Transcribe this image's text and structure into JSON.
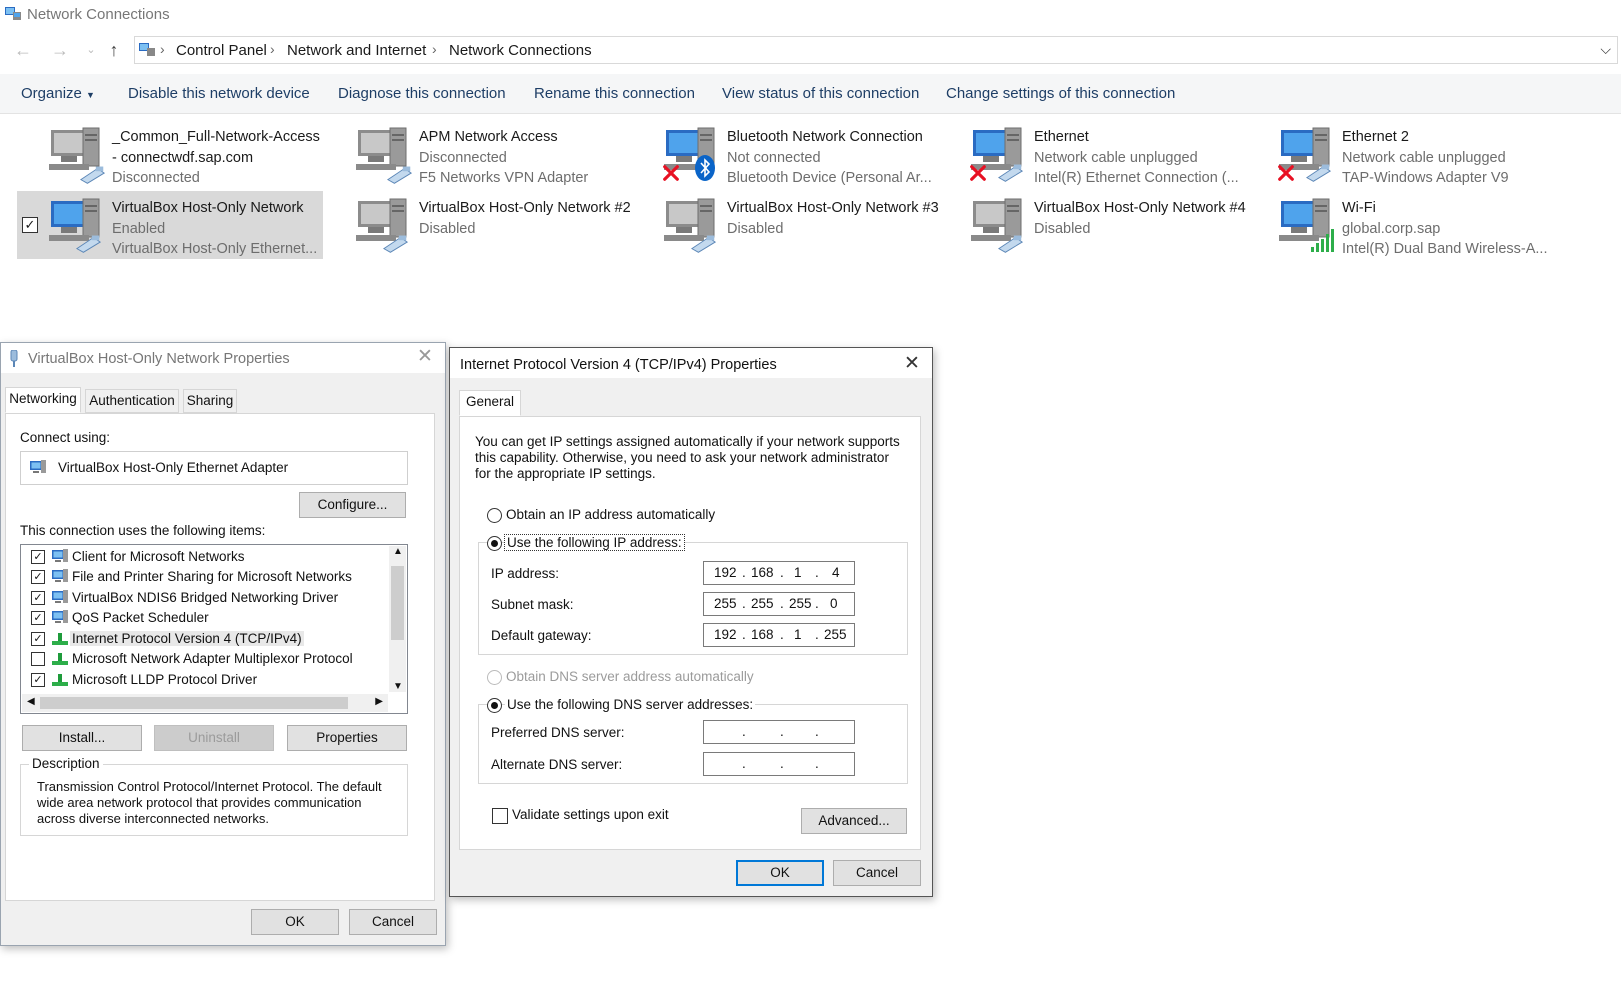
{
  "window": {
    "title": "Network Connections"
  },
  "address": {
    "crumbs": [
      "Control Panel",
      "Network and Internet",
      "Network Connections"
    ]
  },
  "commands": {
    "organize": "Organize",
    "disable": "Disable this network device",
    "diagnose": "Diagnose this connection",
    "rename": "Rename this connection",
    "view_status": "View status of this connection",
    "change_settings": "Change settings of this connection"
  },
  "connections": [
    {
      "name": "_Common_Full-Network-Access - connectwdf.sap.com",
      "status": "Disconnected",
      "device": ""
    },
    {
      "name": "APM Network Access",
      "status": "Disconnected",
      "device": "F5 Networks VPN Adapter"
    },
    {
      "name": "Bluetooth Network Connection",
      "status": "Not connected",
      "device": "Bluetooth Device (Personal Ar..."
    },
    {
      "name": "Ethernet",
      "status": "Network cable unplugged",
      "device": "Intel(R) Ethernet Connection (..."
    },
    {
      "name": "Ethernet 2",
      "status": "Network cable unplugged",
      "device": "TAP-Windows Adapter V9"
    },
    {
      "name": "VirtualBox Host-Only Network",
      "status": "Enabled",
      "device": "VirtualBox Host-Only Ethernet..."
    },
    {
      "name": "VirtualBox Host-Only Network #2",
      "status": "Disabled",
      "device": ""
    },
    {
      "name": "VirtualBox Host-Only Network #3",
      "status": "Disabled",
      "device": ""
    },
    {
      "name": "VirtualBox Host-Only Network #4",
      "status": "Disabled",
      "device": ""
    },
    {
      "name": "Wi-Fi",
      "status": "global.corp.sap",
      "device": "Intel(R) Dual Band Wireless-A..."
    }
  ],
  "props_dialog": {
    "title": "VirtualBox Host-Only Network Properties",
    "tabs": [
      "Networking",
      "Authentication",
      "Sharing"
    ],
    "connect_using_label": "Connect using:",
    "adapter": "VirtualBox Host-Only Ethernet Adapter",
    "configure": "Configure...",
    "items_label": "This connection uses the following items:",
    "items": [
      {
        "label": "Client for Microsoft Networks",
        "checked": true
      },
      {
        "label": "File and Printer Sharing for Microsoft Networks",
        "checked": true
      },
      {
        "label": "VirtualBox NDIS6 Bridged Networking Driver",
        "checked": true
      },
      {
        "label": "QoS Packet Scheduler",
        "checked": true
      },
      {
        "label": "Internet Protocol Version 4 (TCP/IPv4)",
        "checked": true
      },
      {
        "label": "Microsoft Network Adapter Multiplexor Protocol",
        "checked": false
      },
      {
        "label": "Microsoft LLDP Protocol Driver",
        "checked": true
      }
    ],
    "install": "Install...",
    "uninstall": "Uninstall",
    "properties": "Properties",
    "description_label": "Description",
    "description": "Transmission Control Protocol/Internet Protocol. The default wide area network protocol that provides communication across diverse interconnected networks.",
    "ok": "OK",
    "cancel": "Cancel"
  },
  "ipv4_dialog": {
    "title": "Internet Protocol Version 4 (TCP/IPv4) Properties",
    "tab": "General",
    "intro": "You can get IP settings assigned automatically if your network supports this capability. Otherwise, you need to ask your network administrator for the appropriate IP settings.",
    "obtain_ip": "Obtain an IP address automatically",
    "use_ip": "Use the following IP address:",
    "ip_label": "IP address:",
    "ip": [
      "192",
      "168",
      "1",
      "4"
    ],
    "subnet_label": "Subnet mask:",
    "subnet": [
      "255",
      "255",
      "255",
      "0"
    ],
    "gateway_label": "Default gateway:",
    "gateway": [
      "192",
      "168",
      "1",
      "255"
    ],
    "obtain_dns": "Obtain DNS server address automatically",
    "use_dns": "Use the following DNS server addresses:",
    "preferred_dns_label": "Preferred DNS server:",
    "alternate_dns_label": "Alternate DNS server:",
    "validate": "Validate settings upon exit",
    "advanced": "Advanced...",
    "ok": "OK",
    "cancel": "Cancel"
  },
  "colors": {
    "accent": "#0078d7",
    "link": "#1e3e66",
    "selected_tile": "#d9d9d9",
    "error": "#e81123"
  }
}
